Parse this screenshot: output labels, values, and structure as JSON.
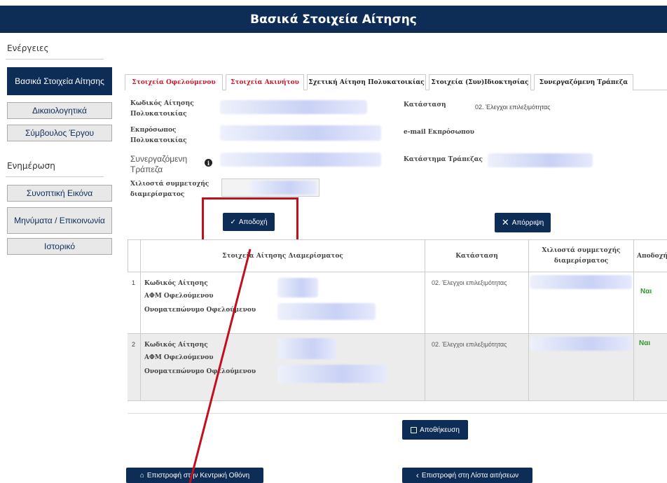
{
  "page": {
    "title": "Βασικά Στοιχεία Αίτησης"
  },
  "sidebar": {
    "actions_title": "Ενέργειες",
    "info_title": "Ενημέρωση",
    "actions": [
      {
        "label": "Βασικά Στοιχεία Αίτησης",
        "active": true
      },
      {
        "label": "Δικαιολογητικά",
        "active": false
      },
      {
        "label": "Σύμβουλος Έργου",
        "active": false
      }
    ],
    "info": [
      {
        "label": "Συνοπτική Εικόνα"
      },
      {
        "label": "Μηνύματα / Επικοινωνία"
      },
      {
        "label": "Ιστορικό"
      }
    ]
  },
  "tabs": [
    {
      "label": "Στοιχεία Οφελούμενου",
      "style": "red"
    },
    {
      "label": "Στοιχεία Ακινήτου",
      "style": "red"
    },
    {
      "label": "Σχετική Αίτηση Πολυκατοικίας",
      "style": "active"
    },
    {
      "label": "Στοιχεία (Συν)Ιδιοκτησίας",
      "style": "normal"
    },
    {
      "label": "Συνεργαζόμενη Τράπεζα",
      "style": "normal"
    }
  ],
  "form": {
    "code_label": "Κωδικός Αίτησης Πολυκατοικίας",
    "rep_label": "Εκπρόσωπος Πολυκατοικίας",
    "bank_label": "Συνεργαζόμενη Τράπεζα",
    "permille_label": "Χιλιοστά συμμετοχής διαμερίσματος",
    "status_label": "Κατάσταση",
    "status_value": "02. Έλεγχοι επιλεξιμότητας",
    "email_label": "e-mail Εκπρόσωπου",
    "branch_label": "Κατάστημα Τράπεζας",
    "info_icon_glyph": "i"
  },
  "buttons": {
    "accept": "Αποδοχή",
    "reject": "Απόρριψη",
    "save": "Αποθήκευση",
    "home": "Επιστροφή στην Κεντρική Οθόνη",
    "back_list": "Επιστροφή στη Λίστα αιτήσεων"
  },
  "table": {
    "headers": {
      "details": "Στοιχεία Αίτησης Διαμερίσματος",
      "status": "Κατάσταση",
      "permille": "Χιλιοστά συμμετοχής διαμερίσματος",
      "accept": "Αποδοχή"
    },
    "rows": [
      {
        "num": "1",
        "code_label": "Κωδικός Αίτησης",
        "afm_label": "ΑΦΜ Οφελούμενου",
        "name_label": "Ονοματεπώνυμο Οφελούμενου",
        "status": "02. Έλεγχοι επιλεξιμότητας",
        "accept": "Ναι"
      },
      {
        "num": "2",
        "code_label": "Κωδικός Αίτησης",
        "afm_label": "ΑΦΜ Οφελούμενου",
        "name_label": "Ονοματεπώνυμο Οφελούμενου",
        "status": "02. Έλεγχοι επιλεξιμότητας",
        "accept": "Ναι"
      }
    ]
  },
  "colors": {
    "navy": "#0d2d57",
    "red_tab": "#d0152a",
    "annotation_red": "#c0101e",
    "yes_green": "#2e9a2e"
  }
}
